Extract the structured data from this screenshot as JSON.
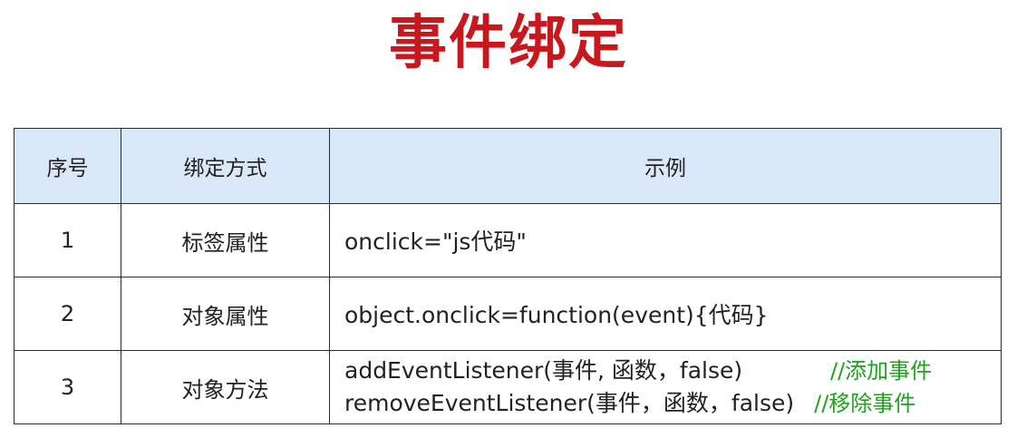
{
  "title": "事件绑定",
  "table": {
    "headers": [
      "序号",
      "绑定方式",
      "示例"
    ],
    "rows": [
      {
        "num": "1",
        "method": "标签属性",
        "example": "onclick=\"js代码\""
      },
      {
        "num": "2",
        "method": "对象属性",
        "example": "object.onclick=function(event){代码}"
      },
      {
        "num": "3",
        "method": "对象方法",
        "lines": [
          {
            "code": "addEventListener(事件, 函数，false)",
            "comment": "//添加事件"
          },
          {
            "code": "removeEventListener(事件，函数，false)",
            "comment": "//移除事件"
          }
        ]
      }
    ]
  },
  "colors": {
    "title": "#c8171d",
    "header_bg": "#dae8fa",
    "comment": "#1ea21e",
    "border": "#2a2a2a"
  }
}
